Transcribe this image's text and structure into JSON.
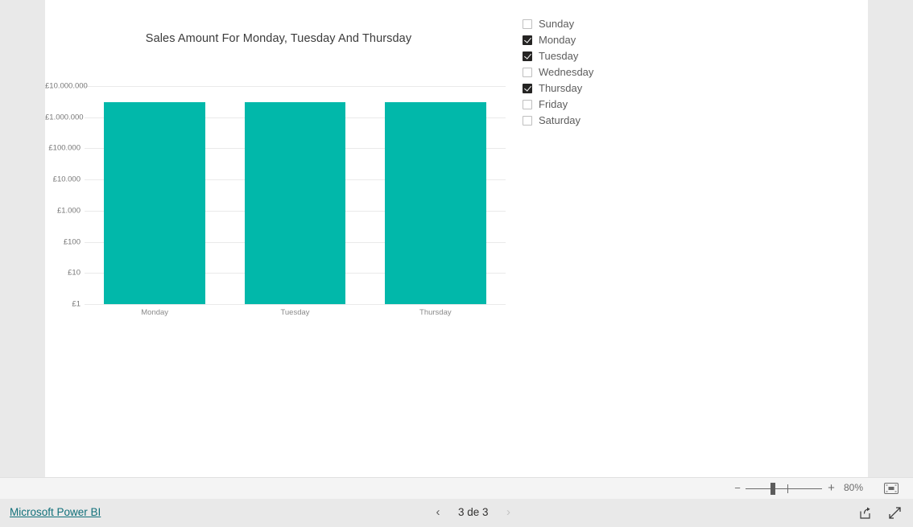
{
  "report": {
    "zoom_level": "80%",
    "page_indicator": "3 de 3",
    "brand_link": "Microsoft Power BI",
    "prev_page_glyph": "‹",
    "next_page_glyph": "›",
    "zoom_out_glyph": "−",
    "zoom_in_glyph": "+",
    "icons": {
      "fit_to_page": "fit-to-page-icon",
      "share": "share-icon",
      "fullscreen": "fullscreen-icon"
    }
  },
  "slicer": {
    "name": "day-of-week-slicer",
    "items": [
      {
        "label": "Sunday",
        "checked": false
      },
      {
        "label": "Monday",
        "checked": true
      },
      {
        "label": "Tuesday",
        "checked": true
      },
      {
        "label": "Wednesday",
        "checked": false
      },
      {
        "label": "Thursday",
        "checked": true
      },
      {
        "label": "Friday",
        "checked": false
      },
      {
        "label": "Saturday",
        "checked": false
      }
    ]
  },
  "chart_data": {
    "type": "bar",
    "title": "Sales Amount For Monday, Tuesday And Thursday",
    "xlabel": "",
    "ylabel": "",
    "categories": [
      "Monday",
      "Tuesday",
      "Thursday"
    ],
    "values": [
      3000000,
      3000000,
      3000000
    ],
    "value_prefix": "£",
    "yscale": "log",
    "ylim": [
      1,
      10000000
    ],
    "ytick_labels": [
      "£10.000.000",
      "£1.000.000",
      "£100.000",
      "£10.000",
      "£1.000",
      "£100",
      "£10",
      "£1"
    ],
    "ytick_values": [
      10000000,
      1000000,
      100000,
      10000,
      1000,
      100,
      10,
      1
    ],
    "grid": true,
    "legend": "none",
    "series_color": "#01b8aa"
  }
}
